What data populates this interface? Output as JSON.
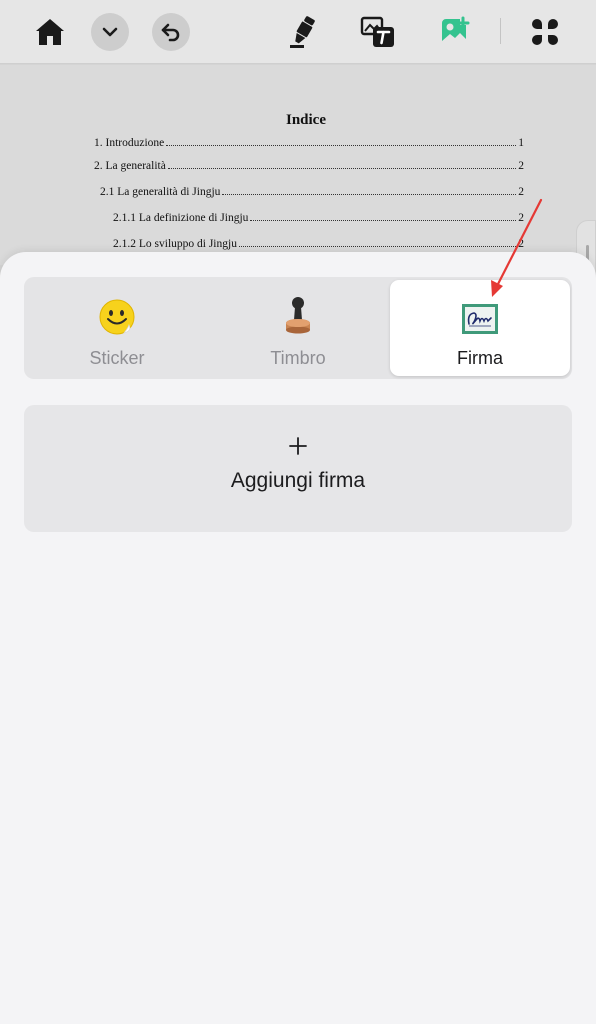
{
  "toolbar": {
    "icons": [
      "home-icon",
      "chevron-down-icon",
      "undo-icon",
      "highlighter-icon",
      "image-text-icon",
      "signature-image-icon",
      "grid-apps-icon"
    ],
    "accent_color": "#34c38f"
  },
  "document": {
    "title": "Indice",
    "toc": [
      {
        "text": "1. Introduzione",
        "page": "1"
      },
      {
        "text": "2. La generalità",
        "page": "2"
      },
      {
        "text": "2.1 La generalità di Jingju",
        "page": "2"
      },
      {
        "text": "2.1.1 La definizione di Jingju",
        "page": "2"
      },
      {
        "text": "2.1.2 Lo sviluppo di Jingju",
        "page": "2"
      }
    ]
  },
  "panel": {
    "tabs": [
      {
        "label": "Sticker",
        "icon": "smiley-sticker-icon"
      },
      {
        "label": "Timbro",
        "icon": "stamp-icon"
      },
      {
        "label": "Firma",
        "icon": "signature-icon"
      }
    ],
    "active_tab": "Firma",
    "add_plus": "+",
    "add_label": "Aggiungi firma"
  },
  "annotation": {
    "arrow_color": "#e53935"
  }
}
